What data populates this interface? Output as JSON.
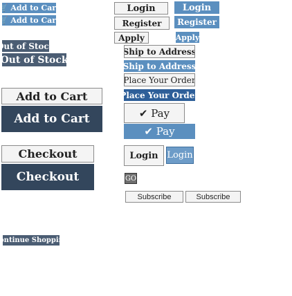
{
  "left": {
    "add_to_cart_1": "🛒 Add to Cart",
    "add_to_cart_2": "🛒 Add to Cart",
    "out_of_stock_1": "Out of Stock",
    "out_of_stock_2": "Out of Stock",
    "add_to_cart_3": "Add to Cart",
    "add_to_cart_4": "Add to Cart",
    "checkout_1": "Checkout",
    "checkout_2": "Checkout",
    "continue_shopping": "Continue Shopping"
  },
  "right": {
    "login_1": "Login",
    "login_2": "Login",
    "register_1": "Register",
    "register_2": "Register",
    "apply_1": "Apply",
    "apply_2": "Apply",
    "ship_1": "Ship to Address",
    "ship_2": "Ship to Address",
    "place_order_1": "Place Your Order",
    "place_order_2": "Place Your Order",
    "pay_1": "✔ Pay",
    "pay_2": "✔ Pay",
    "login_3": "Login",
    "login_4": "Login",
    "go": "GO",
    "subscribe_1": "Subscribe",
    "subscribe_2": "Subscribe"
  },
  "colors": {
    "blue": "#5b8fbf",
    "slate": "#4b5d73",
    "dark_blue": "#2e5f99"
  }
}
